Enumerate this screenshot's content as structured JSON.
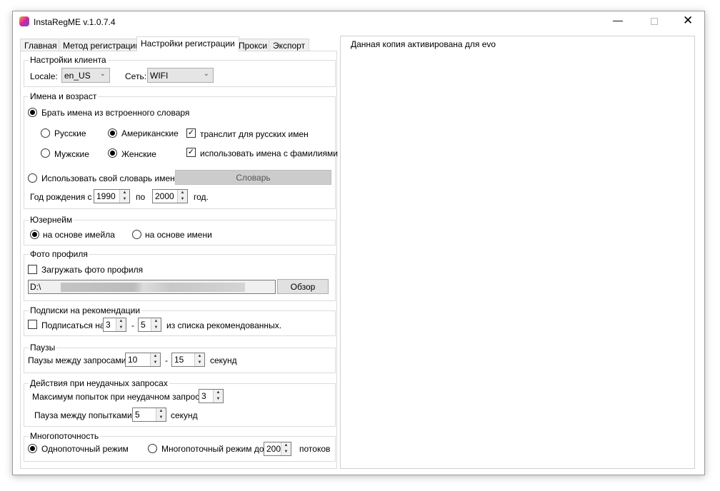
{
  "window": {
    "title": "InstaRegME  v.1.0.7.4"
  },
  "tabs": [
    "Главная",
    "Метод регистрации",
    "Настройки регистрации",
    "Прокси",
    "Экспорт"
  ],
  "activation": "Данная копия активирована для evo",
  "client": {
    "title": "Настройки клиента",
    "locale_label": "Locale:",
    "locale": "en_US",
    "net_label": "Сеть:",
    "net": "WIFI"
  },
  "names": {
    "title": "Имена и возраст",
    "builtin": "Брать имена из встроенного словаря",
    "russian": "Русские",
    "american": "Американские",
    "translit": "транслит для русских имен",
    "male": "Мужские",
    "female": "Женские",
    "surnames": "использовать имена с фамилиями",
    "custom": "Использовать свой словарь имен",
    "dict_button": "Словарь",
    "birth_label": "Год рождения с",
    "birth_from": "1990",
    "to_label": "по",
    "birth_to": "2000",
    "year_label": "год."
  },
  "username": {
    "title": "Юзернейм",
    "email": "на основе имейла",
    "name": "на основе имени"
  },
  "photo": {
    "title": "Фото профиля",
    "load": "Загружать фото профиля",
    "path": "D:\\",
    "browse": "Обзор"
  },
  "follow": {
    "title": "Подписки на рекомендации",
    "label": "Подписаться на",
    "from": "3",
    "dash": "-",
    "to": "5",
    "suffix": "из списка рекомендованных."
  },
  "pauses": {
    "title": "Паузы",
    "label": "Паузы между запросами",
    "from": "10",
    "dash": "-",
    "to": "15",
    "unit": "секунд"
  },
  "fail": {
    "title": "Действия при неудачных запросах",
    "max_label": "Максимум попыток при неудачном запросе",
    "max": "3",
    "pause_label": "Пауза между попытками",
    "pause": "5",
    "unit": "секунд"
  },
  "threads": {
    "title": "Многопоточность",
    "single": "Однопоточный режим",
    "multi": "Многопоточный режим до",
    "count": "200",
    "unit": "потоков"
  }
}
